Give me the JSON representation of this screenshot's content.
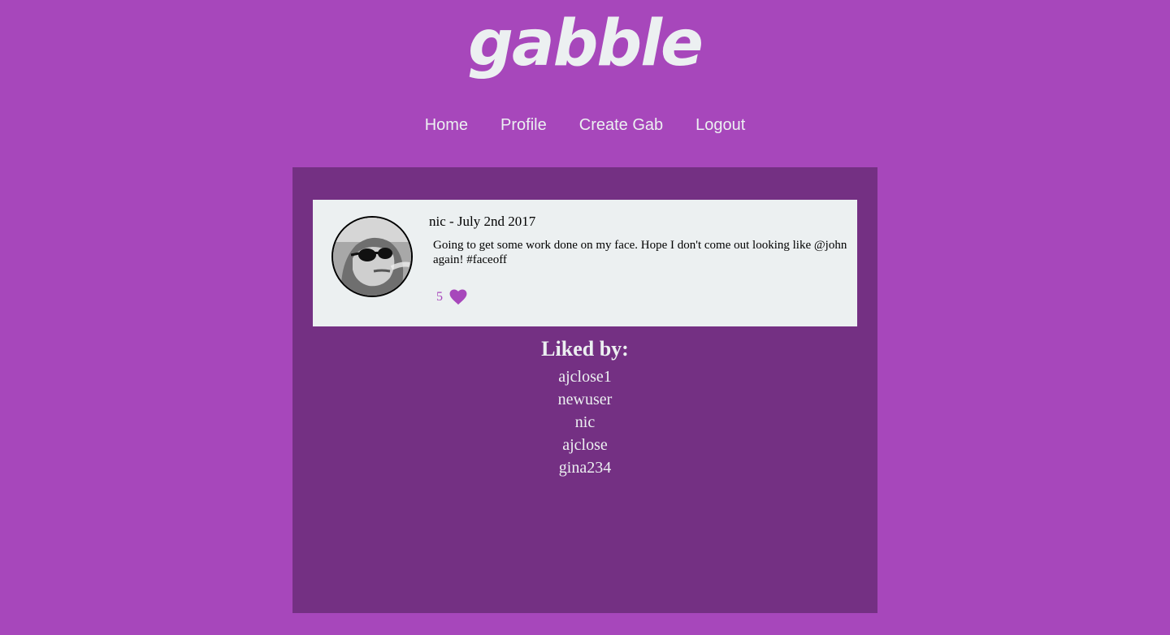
{
  "header": {
    "logo_text": "gabble"
  },
  "nav": {
    "items": [
      {
        "label": "Home"
      },
      {
        "label": "Profile"
      },
      {
        "label": "Create Gab"
      },
      {
        "label": "Logout"
      }
    ]
  },
  "gab": {
    "meta": "nic - July 2nd 2017",
    "body": "Going to get some work done on my face. Hope I don't come out looking like @john again! #faceoff",
    "like_count": "5",
    "like_icon": "heart-icon",
    "avatar_icon": "avatar-photo"
  },
  "liked_by": {
    "heading": "Liked by:",
    "users": [
      "ajclose1",
      "newuser",
      "nic",
      "ajclose",
      "gina234"
    ]
  },
  "colors": {
    "background": "#a747bb",
    "panel": "#743083",
    "card": "#ecf0f1",
    "accent": "#a747bb",
    "text_light": "#ecf0f1"
  }
}
